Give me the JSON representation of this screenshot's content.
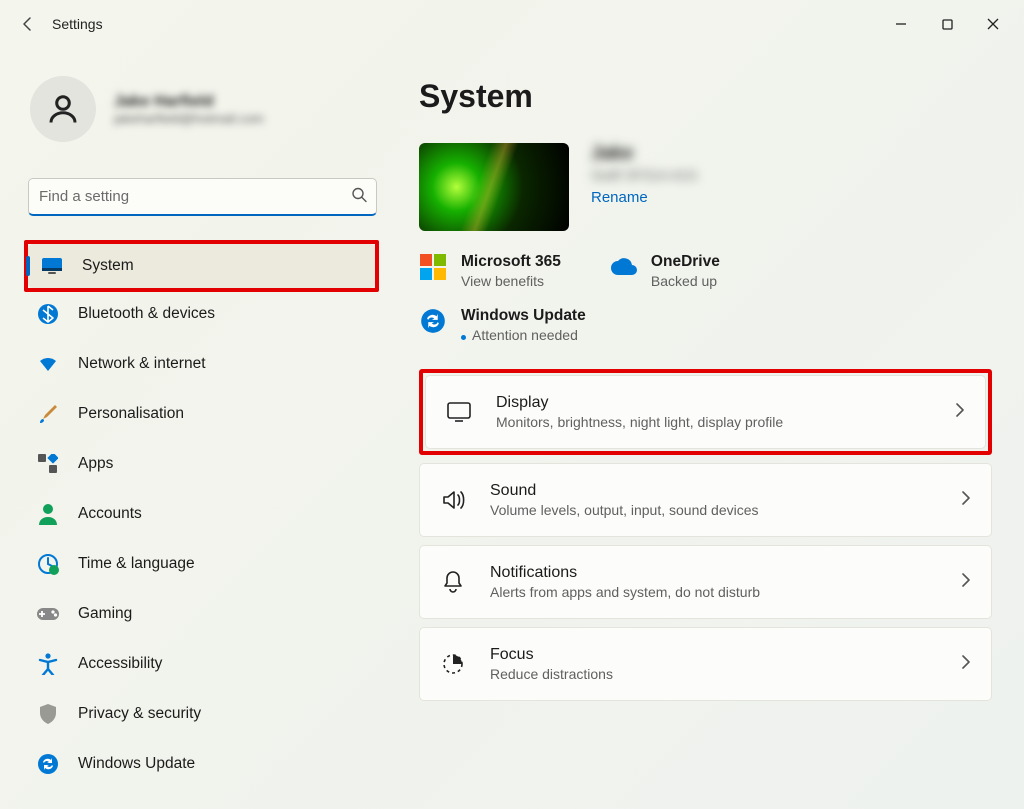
{
  "window": {
    "title": "Settings"
  },
  "user": {
    "name": "Jake Harfield",
    "email": "jakeharfield@hotmail.com"
  },
  "search": {
    "placeholder": "Find a setting"
  },
  "nav": [
    {
      "label": "System",
      "icon": "monitor",
      "active": true
    },
    {
      "label": "Bluetooth & devices",
      "icon": "bluetooth",
      "active": false
    },
    {
      "label": "Network & internet",
      "icon": "wifi",
      "active": false
    },
    {
      "label": "Personalisation",
      "icon": "brush",
      "active": false
    },
    {
      "label": "Apps",
      "icon": "apps",
      "active": false
    },
    {
      "label": "Accounts",
      "icon": "person",
      "active": false
    },
    {
      "label": "Time & language",
      "icon": "clock-globe",
      "active": false
    },
    {
      "label": "Gaming",
      "icon": "gamepad",
      "active": false
    },
    {
      "label": "Accessibility",
      "icon": "accessibility",
      "active": false
    },
    {
      "label": "Privacy & security",
      "icon": "shield",
      "active": false
    },
    {
      "label": "Windows Update",
      "icon": "update",
      "active": false
    }
  ],
  "page": {
    "title": "System",
    "device": {
      "name": "Jake",
      "model": "Swift SF314-41G",
      "rename": "Rename"
    },
    "status": [
      {
        "title": "Microsoft 365",
        "sub": "View benefits",
        "icon": "ms365"
      },
      {
        "title": "OneDrive",
        "sub": "Backed up",
        "icon": "onedrive"
      },
      {
        "title": "Windows Update",
        "sub": "Attention needed",
        "icon": "update",
        "dot": true
      }
    ],
    "cards": [
      {
        "title": "Display",
        "sub": "Monitors, brightness, night light, display profile",
        "icon": "display",
        "highlight": true
      },
      {
        "title": "Sound",
        "sub": "Volume levels, output, input, sound devices",
        "icon": "sound"
      },
      {
        "title": "Notifications",
        "sub": "Alerts from apps and system, do not disturb",
        "icon": "bell"
      },
      {
        "title": "Focus",
        "sub": "Reduce distractions",
        "icon": "focus"
      }
    ]
  }
}
